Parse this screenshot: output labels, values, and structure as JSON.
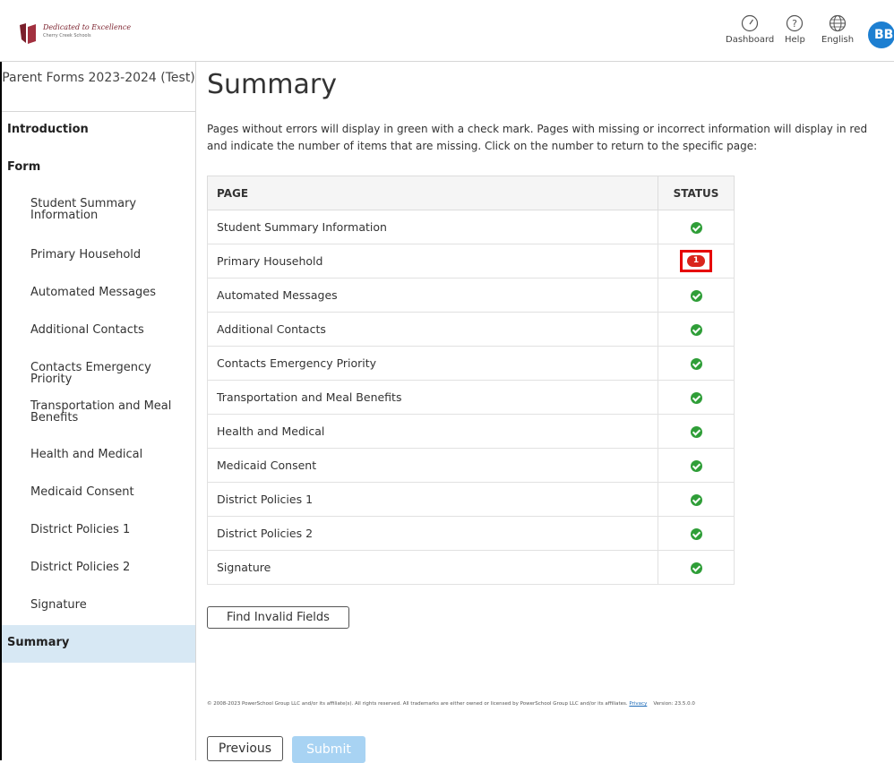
{
  "header": {
    "logo_title": "Dedicated to Excellence",
    "logo_subtitle": "Cherry Creek Schools",
    "nav": [
      {
        "label": "Dashboard",
        "icon": "dashboard-icon"
      },
      {
        "label": "Help",
        "icon": "help-icon"
      },
      {
        "label": "English",
        "icon": "globe-icon"
      }
    ],
    "avatar_initials": "BB"
  },
  "sidebar": {
    "title": "Parent Forms 2023-2024 (Test)",
    "sections": [
      {
        "label": "Introduction"
      },
      {
        "label": "Form"
      }
    ],
    "items": [
      {
        "label": "Student Summary Information"
      },
      {
        "label": "Primary Household"
      },
      {
        "label": "Automated Messages"
      },
      {
        "label": "Additional Contacts"
      },
      {
        "label": "Contacts Emergency Priority"
      },
      {
        "label": "Transportation and Meal Benefits"
      },
      {
        "label": "Health and Medical"
      },
      {
        "label": "Medicaid Consent"
      },
      {
        "label": "District Policies 1"
      },
      {
        "label": "District Policies 2"
      },
      {
        "label": "Signature"
      }
    ],
    "active": "Summary"
  },
  "main": {
    "title": "Summary",
    "intro_line1": "Pages without errors will display in green with a check mark. Pages with missing or incorrect information will display in red",
    "intro_line2": "and indicate the number of items that are missing. Click on the number to return to the specific page:",
    "table": {
      "headers": [
        "PAGE",
        "STATUS"
      ],
      "rows": [
        {
          "page": "Student Summary Information",
          "status": "ok"
        },
        {
          "page": "Primary Household",
          "status": "error",
          "error_count": "1"
        },
        {
          "page": "Automated Messages",
          "status": "ok"
        },
        {
          "page": "Additional Contacts",
          "status": "ok"
        },
        {
          "page": "Contacts Emergency Priority",
          "status": "ok"
        },
        {
          "page": "Transportation and Meal Benefits",
          "status": "ok"
        },
        {
          "page": "Health and Medical",
          "status": "ok"
        },
        {
          "page": "Medicaid Consent",
          "status": "ok"
        },
        {
          "page": "District Policies 1",
          "status": "ok"
        },
        {
          "page": "District Policies 2",
          "status": "ok"
        },
        {
          "page": "Signature",
          "status": "ok"
        }
      ]
    },
    "find_button": "Find Invalid Fields",
    "footer_text": "© 2008-2023 PowerSchool Group LLC and/or its affiliate(s). All rights reserved. All trademarks are either owned or licensed by PowerSchool Group LLC and/or its affiliates.",
    "footer_link": "Privacy",
    "footer_version": "Version: 23.5.0.0",
    "previous_button": "Previous",
    "submit_button": "Submit"
  },
  "colors": {
    "ok": "#2f9e38",
    "error": "#d9251c",
    "active_bg": "#d7e8f4",
    "avatar": "#1d7fd1",
    "submit_disabled": "#a8d3f3"
  }
}
